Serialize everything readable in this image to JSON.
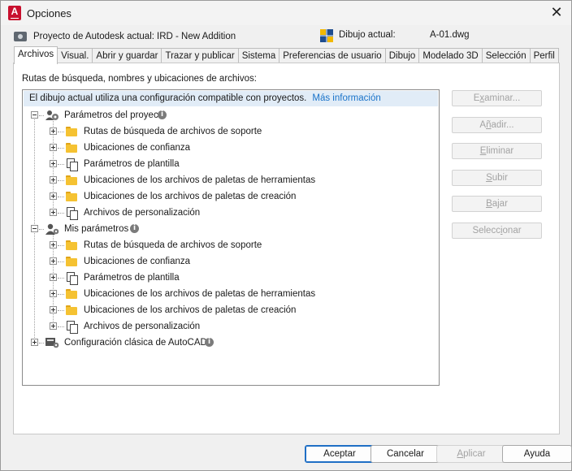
{
  "window": {
    "title": "Opciones",
    "close_glyph": "✕"
  },
  "info": {
    "project_label": "Proyecto de Autodesk actual:",
    "project_value": "IRD - New Addition",
    "drawing_label": "Dibujo actual:",
    "drawing_value": "A-01.dwg"
  },
  "tabs": [
    {
      "label": "Archivos",
      "active": true
    },
    {
      "label": "Visual."
    },
    {
      "label": "Abrir y guardar"
    },
    {
      "label": "Trazar y publicar"
    },
    {
      "label": "Sistema"
    },
    {
      "label": "Preferencias de usuario"
    },
    {
      "label": "Dibujo"
    },
    {
      "label": "Modelado 3D"
    },
    {
      "label": "Selección"
    },
    {
      "label": "Perfil"
    }
  ],
  "panel": {
    "caption": "Rutas de búsqueda, nombres y ubicaciones de archivos:",
    "banner_text": "El dibujo actual utiliza una configuración compatible con proyectos.",
    "banner_link": "Más información"
  },
  "tree": {
    "project_group": "Parámetros del proyecto",
    "my_group": "Mis parámetros",
    "classic_group": "Configuración clásica de AutoCAD",
    "info_glyph": "i",
    "project_items": [
      {
        "label": "Rutas de búsqueda de archivos de soporte",
        "icon": "folder-icon"
      },
      {
        "label": "Ubicaciones de confianza",
        "icon": "folder-icon"
      },
      {
        "label": "Parámetros de plantilla",
        "icon": "files-icon"
      },
      {
        "label": "Ubicaciones de los archivos de paletas de herramientas",
        "icon": "folder-icon"
      },
      {
        "label": "Ubicaciones de los archivos de paletas de creación",
        "icon": "folder-icon"
      },
      {
        "label": "Archivos de personalización",
        "icon": "files-icon"
      }
    ],
    "my_items": [
      {
        "label": "Rutas de búsqueda de archivos de soporte",
        "icon": "folder-icon"
      },
      {
        "label": "Ubicaciones de confianza",
        "icon": "folder-icon"
      },
      {
        "label": "Parámetros de plantilla",
        "icon": "files-icon"
      },
      {
        "label": "Ubicaciones de los archivos de paletas de herramientas",
        "icon": "folder-icon"
      },
      {
        "label": "Ubicaciones de los archivos de paletas de creación",
        "icon": "folder-icon"
      },
      {
        "label": "Archivos de personalización",
        "icon": "files-icon"
      }
    ]
  },
  "side_buttons": [
    {
      "pre": "E",
      "u": "x",
      "post": "aminar...",
      "name": "examinar-button"
    },
    {
      "pre": "A",
      "u": "ñ",
      "post": "adir...",
      "name": "anadir-button"
    },
    {
      "pre": "",
      "u": "E",
      "post": "liminar",
      "name": "eliminar-button"
    },
    {
      "pre": "",
      "u": "S",
      "post": "ubir",
      "name": "subir-button"
    },
    {
      "pre": "",
      "u": "B",
      "post": "ajar",
      "name": "bajar-button"
    },
    {
      "pre": "Selecc",
      "u": "i",
      "post": "onar",
      "name": "seleccionar-button"
    }
  ],
  "bottom_buttons": {
    "ok": "Aceptar",
    "cancel": "Cancelar",
    "apply_pre": "",
    "apply_u": "A",
    "apply_post": "plicar",
    "help": "Ayuda"
  },
  "colors": {
    "accent": "#1f6fc5",
    "banner_bg": "#e1ecf7",
    "link": "#1a73c9",
    "app_icon": "#c8102e",
    "folder": "#f5c232"
  }
}
